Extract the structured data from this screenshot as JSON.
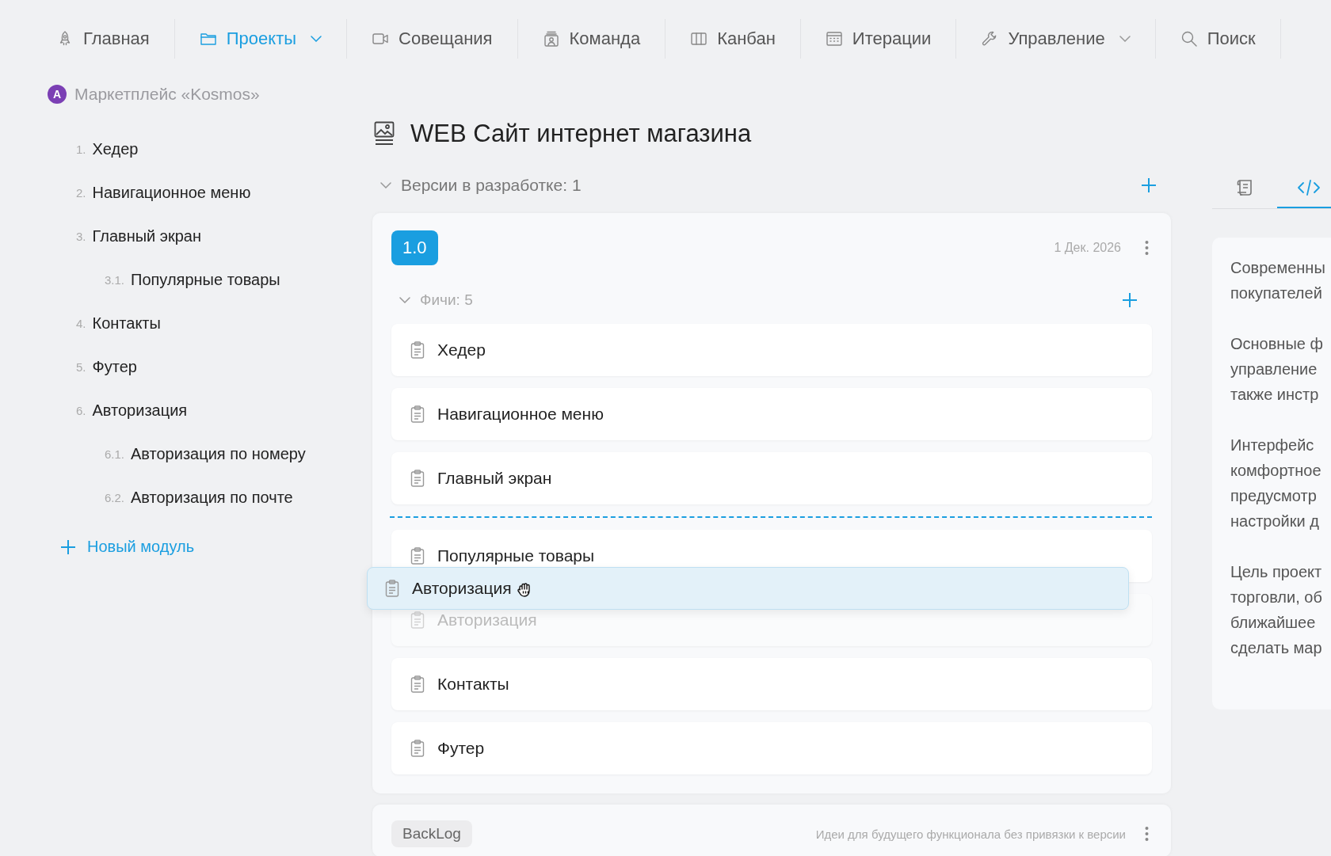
{
  "nav": [
    {
      "label": "Главная",
      "selected": false,
      "dropdown": false
    },
    {
      "label": "Проекты",
      "selected": true,
      "dropdown": true
    },
    {
      "label": "Совещания",
      "selected": false,
      "dropdown": false
    },
    {
      "label": "Команда",
      "selected": false,
      "dropdown": false
    },
    {
      "label": "Канбан",
      "selected": false,
      "dropdown": false
    },
    {
      "label": "Итерации",
      "selected": false,
      "dropdown": false
    },
    {
      "label": "Управление",
      "selected": false,
      "dropdown": true
    },
    {
      "label": "Поиск",
      "selected": false,
      "dropdown": false
    }
  ],
  "project": {
    "avatar": "A",
    "name": "Маркетплейс «Kosmos»"
  },
  "modules": [
    {
      "number": "1.",
      "label": "Хедер"
    },
    {
      "number": "2.",
      "label": "Навигационное меню"
    },
    {
      "number": "3.",
      "label": "Главный экран",
      "children": [
        {
          "number": "3.1.",
          "label": "Популярные товары"
        }
      ]
    },
    {
      "number": "4.",
      "label": "Контакты"
    },
    {
      "number": "5.",
      "label": "Футер"
    },
    {
      "number": "6.",
      "label": "Авторизация",
      "children": [
        {
          "number": "6.1.",
          "label": "Авторизация по номеру"
        },
        {
          "number": "6.2.",
          "label": "Авторизация по почте"
        }
      ]
    }
  ],
  "new_module": "Новый модуль",
  "page_title": "WEB Сайт интернет магазина",
  "versions": {
    "label": "Версии в разработке: 1",
    "expanded": true
  },
  "version": {
    "badge": "1.0",
    "date": "1 Дек. 2026",
    "features_label": "Фичи: 5",
    "features_expanded": true,
    "features": [
      {
        "label": "Хедер",
        "ghost": false,
        "drop_before": false
      },
      {
        "label": "Навигационное меню",
        "ghost": false,
        "drop_before": false
      },
      {
        "label": "Главный экран",
        "ghost": false,
        "drop_before": false
      },
      {
        "label": "Популярные товары",
        "ghost": false,
        "drop_before": true
      },
      {
        "label": "Авторизация",
        "ghost": true,
        "drop_before": false
      },
      {
        "label": "Контакты",
        "ghost": false,
        "drop_before": false
      },
      {
        "label": "Футер",
        "ghost": false,
        "drop_before": false
      }
    ],
    "dragging": {
      "label": "Авторизация"
    }
  },
  "backlog": {
    "badge": "BackLog",
    "description": "Идеи для будущего функционала без привязки к версии"
  },
  "side_tabs": [
    {
      "selected": false
    },
    {
      "selected": true
    }
  ],
  "description": [
    [
      "Современны",
      "покупателей"
    ],
    [
      "Основные ф",
      "управление",
      "также инстр"
    ],
    [
      "Интерфейс",
      "комфортное",
      "предусмотр",
      "настройки д"
    ],
    [
      "Цель проект",
      "торговли, об",
      "ближайшее",
      "сделать мар"
    ]
  ]
}
